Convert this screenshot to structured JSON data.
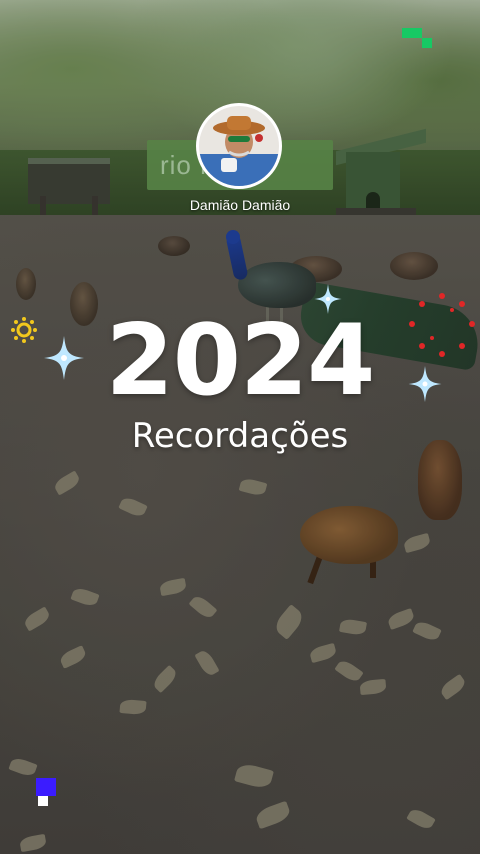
{
  "story": {
    "user_name": "Damião Damião",
    "year": "2024",
    "subtitle": "Recordações",
    "background_sign_text": "rio            ro"
  },
  "colors": {
    "text": "#ffffff",
    "sparkle": "#bfe8ff",
    "accent_green": "#17c964",
    "accent_blue": "#3b1cff",
    "sun_yellow": "#f2c81d",
    "dots_red": "#e12727"
  },
  "icons": {
    "sparkle": "four-point-star",
    "sun": "sun-icon",
    "corner_top_right": "pixel-blocks-green",
    "corner_bottom_left": "pixel-blocks-blue"
  }
}
